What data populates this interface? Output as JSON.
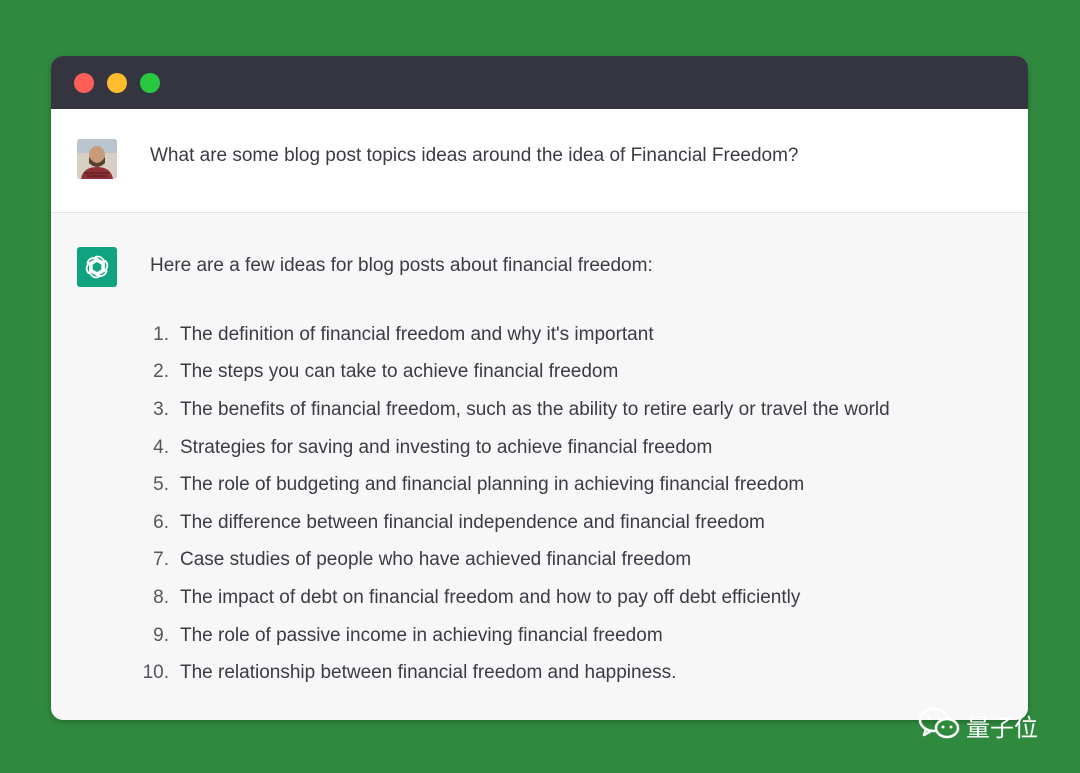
{
  "conversation": {
    "user_message": "What are some blog post topics ideas around the idea of Financial Freedom?",
    "assistant_intro": "Here are a few ideas for blog posts about financial freedom:",
    "ideas": [
      {
        "num": "1.",
        "text": "The definition of financial freedom and why it's important"
      },
      {
        "num": "2.",
        "text": "The steps you can take to achieve financial freedom"
      },
      {
        "num": "3.",
        "text": "The benefits of financial freedom, such as the ability to retire early or travel the world"
      },
      {
        "num": "4.",
        "text": "Strategies for saving and investing to achieve financial freedom"
      },
      {
        "num": "5.",
        "text": "The role of budgeting and financial planning in achieving financial freedom"
      },
      {
        "num": "6.",
        "text": "The difference between financial independence and financial freedom"
      },
      {
        "num": "7.",
        "text": "Case studies of people who have achieved financial freedom"
      },
      {
        "num": "8.",
        "text": "The impact of debt on financial freedom and how to pay off debt efficiently"
      },
      {
        "num": "9.",
        "text": "The role of passive income in achieving financial freedom"
      },
      {
        "num": "10.",
        "text": "The relationship between financial freedom and happiness."
      }
    ]
  },
  "watermark": {
    "icon": "wechat-icon",
    "text": "量子位"
  },
  "colors": {
    "background": "#2f8a3e",
    "titlebar": "#343541",
    "assistant_accent": "#10a37f"
  }
}
